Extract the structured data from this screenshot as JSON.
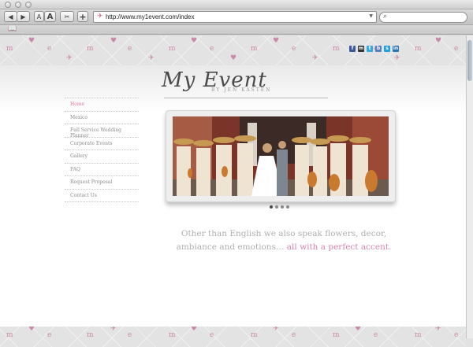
{
  "browser": {
    "url": "http://www.my1event.com/index",
    "text_smaller_label": "A",
    "text_bigger_label": "A",
    "add_label": "+",
    "icons": [
      "back-icon",
      "forward-icon",
      "snip-icon",
      "search-icon",
      "bookmarks-icon",
      "dropdown-icon"
    ]
  },
  "header": {
    "logo_script": "My Event",
    "logo_sub": "BY JEN KASTEN",
    "social_icons": [
      {
        "name": "facebook-icon",
        "glyph": "f",
        "color": "#3b5998"
      },
      {
        "name": "myspace-icon",
        "glyph": "m",
        "color": "#333333"
      },
      {
        "name": "twitter-icon",
        "glyph": "t",
        "color": "#33aadd"
      },
      {
        "name": "blog-icon",
        "glyph": "b",
        "color": "#5a7fb8"
      },
      {
        "name": "skype-icon",
        "glyph": "s",
        "color": "#21a1e0"
      },
      {
        "name": "linkedin-icon",
        "glyph": "in",
        "color": "#2a74b0"
      }
    ]
  },
  "nav": {
    "items": [
      {
        "label": "Home",
        "active": true
      },
      {
        "label": "Mexico",
        "active": false
      },
      {
        "label": "Full Service Wedding Planner",
        "active": false
      },
      {
        "label": "Corporate Events",
        "active": false
      },
      {
        "label": "Gallery",
        "active": false
      },
      {
        "label": "FAQ",
        "active": false
      },
      {
        "label": "Request Proposal",
        "active": false
      },
      {
        "label": "Contact Us",
        "active": false
      }
    ]
  },
  "slideshow": {
    "slide_count": 4,
    "active_index": 0
  },
  "tagline": {
    "main": "Other than English we also speak flowers, decor, ambiance and emotions…",
    "accent": "all with a perfect accent."
  },
  "colors": {
    "accent_pink": "#d884b4",
    "nav_text": "#8a8a8a"
  }
}
